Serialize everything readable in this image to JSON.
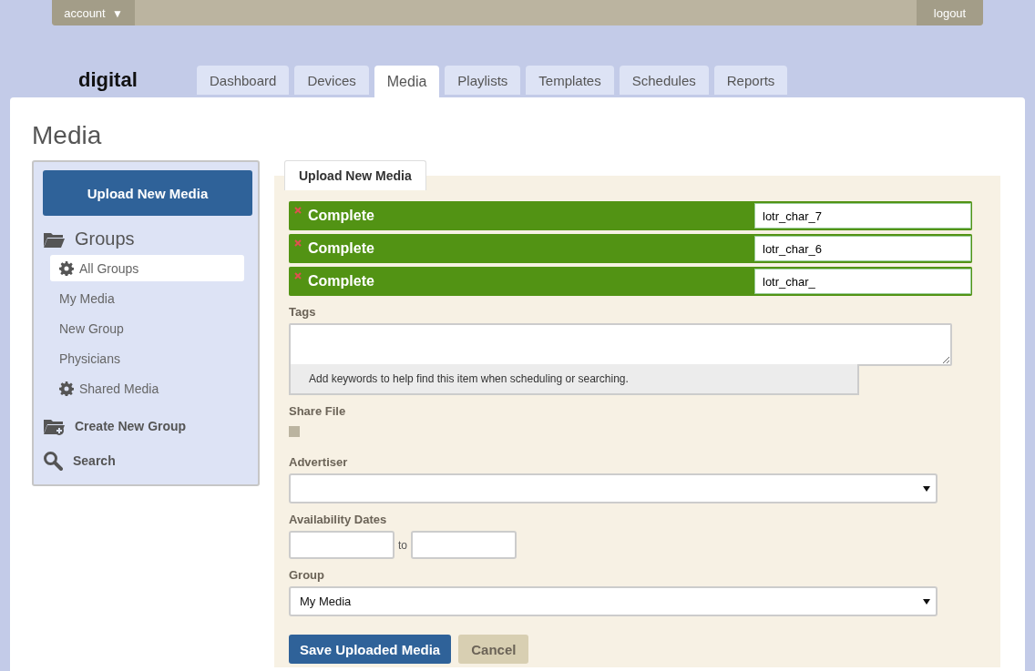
{
  "topbar": {
    "account": "account",
    "account_caret": "▼",
    "logout": "logout"
  },
  "logo": "digital",
  "tabs": [
    {
      "label": "Dashboard",
      "selected": false
    },
    {
      "label": "Devices",
      "selected": false
    },
    {
      "label": "Media",
      "selected": true
    },
    {
      "label": "Playlists",
      "selected": false
    },
    {
      "label": "Templates",
      "selected": false
    },
    {
      "label": "Schedules",
      "selected": false
    },
    {
      "label": "Reports",
      "selected": false
    }
  ],
  "page_title": "Media",
  "sidebar": {
    "upload_button": "Upload New Media",
    "groups_heading": "Groups",
    "items": [
      {
        "label": "All Groups",
        "kind": "gear",
        "selected": true
      },
      {
        "label": "My Media",
        "kind": "plain",
        "selected": false
      },
      {
        "label": "New Group",
        "kind": "plain",
        "selected": false
      },
      {
        "label": "Physicians",
        "kind": "plain",
        "selected": false
      },
      {
        "label": "Shared Media",
        "kind": "gear",
        "selected": false
      }
    ],
    "create_group": "Create New Group",
    "search": "Search"
  },
  "panel": {
    "tab": "Upload New Media",
    "uploads": [
      {
        "status": "Complete",
        "name": "lotr_char_7",
        "level": 1
      },
      {
        "status": "Complete",
        "name": "lotr_char_6",
        "level": 1
      },
      {
        "status": "Complete",
        "name": "lotr_char_",
        "level": 1
      }
    ],
    "tags_label": "Tags",
    "tags_help": "Add keywords to help find this item when scheduling or searching.",
    "share_label": "Share File",
    "share_checked": false,
    "advertiser_label": "Advertiser",
    "dates_label": "Availability Dates",
    "dates_to": "to",
    "group_label": "Group",
    "group_value": "My Media",
    "save_button": "Save Uploaded Media",
    "cancel_button": "Cancel"
  }
}
